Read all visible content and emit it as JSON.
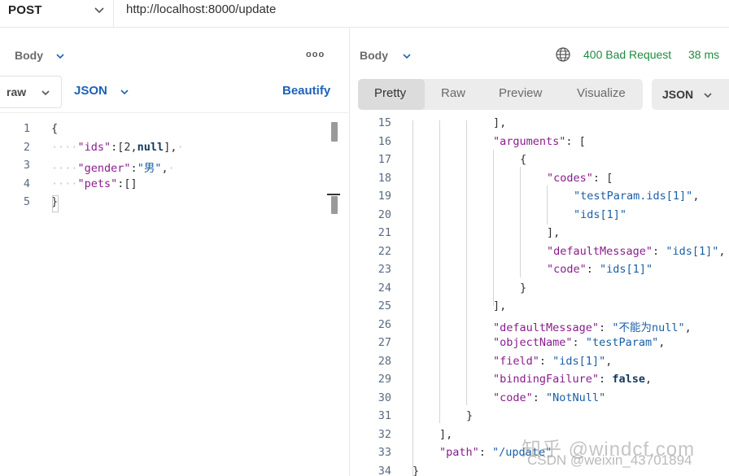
{
  "request": {
    "method": "POST",
    "url": "http://localhost:8000/update"
  },
  "left": {
    "title": "Body",
    "more": "ooo",
    "body_type": "raw",
    "format": "JSON",
    "beautify": "Beautify",
    "lines": [
      {
        "n": "1",
        "parts": [
          {
            "t": "pun",
            "v": "{"
          }
        ]
      },
      {
        "n": "2",
        "parts": [
          {
            "t": "ws",
            "v": "····"
          },
          {
            "t": "key",
            "v": "\"ids\""
          },
          {
            "t": "pun",
            "v": ":[2,"
          },
          {
            "t": "kw",
            "v": "null"
          },
          {
            "t": "pun",
            "v": "],"
          },
          {
            "t": "ws",
            "v": "·"
          }
        ]
      },
      {
        "n": "3",
        "parts": [
          {
            "t": "ws",
            "v": "····"
          },
          {
            "t": "key",
            "v": "\"gender\""
          },
          {
            "t": "pun",
            "v": ":"
          },
          {
            "t": "str",
            "v": "\"男\""
          },
          {
            "t": "pun",
            "v": ","
          },
          {
            "t": "ws",
            "v": "·"
          }
        ]
      },
      {
        "n": "4",
        "parts": [
          {
            "t": "ws",
            "v": "····"
          },
          {
            "t": "key",
            "v": "\"pets\""
          },
          {
            "t": "pun",
            "v": ":[]"
          }
        ]
      },
      {
        "n": "5",
        "parts": [
          {
            "t": "pun",
            "v": "}"
          }
        ]
      }
    ]
  },
  "right": {
    "title": "Body",
    "status": "400 Bad Request",
    "time": "38 ms",
    "tabs": [
      "Pretty",
      "Raw",
      "Preview",
      "Visualize"
    ],
    "format": "JSON",
    "lines": [
      {
        "n": "15",
        "parts": [
          {
            "t": "pun",
            "v": "],"
          }
        ]
      },
      {
        "n": "16",
        "parts": [
          {
            "t": "key",
            "v": "\"arguments\""
          },
          {
            "t": "pun",
            "v": ": ["
          }
        ]
      },
      {
        "n": "17",
        "parts": [
          {
            "t": "pun",
            "v": "{"
          }
        ]
      },
      {
        "n": "18",
        "parts": [
          {
            "t": "key",
            "v": "\"codes\""
          },
          {
            "t": "pun",
            "v": ": ["
          }
        ]
      },
      {
        "n": "19",
        "parts": [
          {
            "t": "str",
            "v": "\"testParam.ids[1]\""
          },
          {
            "t": "pun",
            "v": ","
          }
        ]
      },
      {
        "n": "20",
        "parts": [
          {
            "t": "str",
            "v": "\"ids[1]\""
          }
        ]
      },
      {
        "n": "21",
        "parts": [
          {
            "t": "pun",
            "v": "],"
          }
        ]
      },
      {
        "n": "22",
        "parts": [
          {
            "t": "key",
            "v": "\"defaultMessage\""
          },
          {
            "t": "pun",
            "v": ": "
          },
          {
            "t": "str",
            "v": "\"ids[1]\""
          },
          {
            "t": "pun",
            "v": ","
          }
        ]
      },
      {
        "n": "23",
        "parts": [
          {
            "t": "key",
            "v": "\"code\""
          },
          {
            "t": "pun",
            "v": ": "
          },
          {
            "t": "str",
            "v": "\"ids[1]\""
          }
        ]
      },
      {
        "n": "24",
        "parts": [
          {
            "t": "pun",
            "v": "}"
          }
        ]
      },
      {
        "n": "25",
        "parts": [
          {
            "t": "pun",
            "v": "],"
          }
        ]
      },
      {
        "n": "26",
        "parts": [
          {
            "t": "key",
            "v": "\"defaultMessage\""
          },
          {
            "t": "pun",
            "v": ": "
          },
          {
            "t": "str",
            "v": "\"不能为null\""
          },
          {
            "t": "pun",
            "v": ","
          }
        ]
      },
      {
        "n": "27",
        "parts": [
          {
            "t": "key",
            "v": "\"objectName\""
          },
          {
            "t": "pun",
            "v": ": "
          },
          {
            "t": "str",
            "v": "\"testParam\""
          },
          {
            "t": "pun",
            "v": ","
          }
        ]
      },
      {
        "n": "28",
        "parts": [
          {
            "t": "key",
            "v": "\"field\""
          },
          {
            "t": "pun",
            "v": ": "
          },
          {
            "t": "str",
            "v": "\"ids[1]\""
          },
          {
            "t": "pun",
            "v": ","
          }
        ]
      },
      {
        "n": "29",
        "parts": [
          {
            "t": "key",
            "v": "\"bindingFailure\""
          },
          {
            "t": "pun",
            "v": ": "
          },
          {
            "t": "kw",
            "v": "false"
          },
          {
            "t": "pun",
            "v": ","
          }
        ]
      },
      {
        "n": "30",
        "parts": [
          {
            "t": "key",
            "v": "\"code\""
          },
          {
            "t": "pun",
            "v": ": "
          },
          {
            "t": "str",
            "v": "\"NotNull\""
          }
        ]
      },
      {
        "n": "31",
        "parts": [
          {
            "t": "pun",
            "v": "}"
          }
        ]
      },
      {
        "n": "32",
        "parts": [
          {
            "t": "pun",
            "v": "],"
          }
        ]
      },
      {
        "n": "33",
        "parts": [
          {
            "t": "key",
            "v": "\"path\""
          },
          {
            "t": "pun",
            "v": ": "
          },
          {
            "t": "str",
            "v": "\"/update\""
          }
        ]
      },
      {
        "n": "34",
        "parts": [
          {
            "t": "pun",
            "v": "}"
          }
        ]
      }
    ]
  },
  "watermark": {
    "line1": "知乎 @windcf.com",
    "line2": "CSDN @weixin_43701894"
  },
  "colors": {
    "accent": "#1c63b7",
    "status_error_text": "#1f8a3f",
    "key": "#8a1c8c",
    "string": "#1a5fa6"
  }
}
